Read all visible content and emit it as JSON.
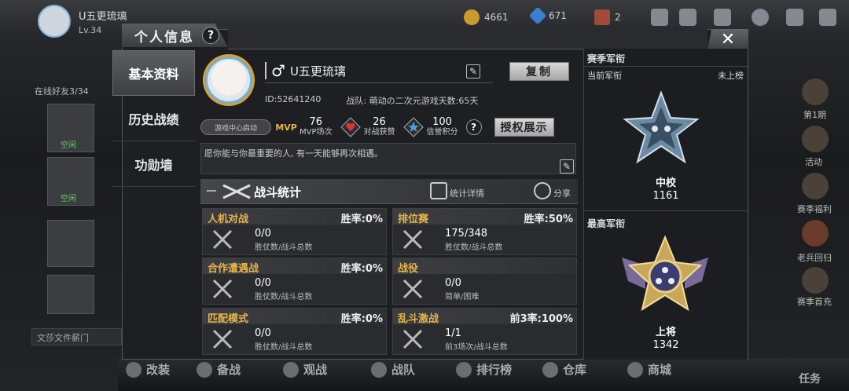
{
  "topbar": {
    "player_name": "U五更琉璃",
    "level": "Lv.34",
    "gold": "4661",
    "diamond": "671",
    "tickets": "2"
  },
  "bg": {
    "online_friends": "在线好友3/34",
    "friend1_status": "空闲",
    "friend2_status": "空闲",
    "chat_text": "文莎文件薪门",
    "right_items": [
      "第1期",
      "活动",
      "赛季福利",
      "老兵回归",
      "赛季首充"
    ],
    "bottom_items": [
      "改装",
      "备战",
      "观战",
      "战队",
      "排行榜",
      "仓库",
      "商城"
    ],
    "task": "任务"
  },
  "modal": {
    "title": "个人信息",
    "help": "?",
    "close": "✕"
  },
  "nav": {
    "items": [
      {
        "label": "基本资料"
      },
      {
        "label": "历史战绩"
      },
      {
        "label": "功勋墙"
      }
    ]
  },
  "profile": {
    "gender_symbol": "♂",
    "name": "U五更琉璃",
    "copy_label": "复制",
    "id_line": "ID:52641240",
    "team_line": "战队:  萌动の二次元游戏天数:65天",
    "game_center": "游戏中心启动",
    "mvp_value": "76",
    "mvp_label": "MVP场次",
    "likes_value": "26",
    "likes_label": "对战获赞",
    "credit_value": "100",
    "credit_label": "信誉积分",
    "help": "?",
    "auth_label": "授权展示",
    "motto": "愿你能与你最重要的人, 有一天能够再次相遇。"
  },
  "battle": {
    "title": "战斗统计",
    "details": "统计详情",
    "share": "分享",
    "cards": [
      {
        "name": "人机对战",
        "rate": "胜率:0%",
        "value": "0/0",
        "sub": "胜仗数/战斗总数"
      },
      {
        "name": "排位赛",
        "rate": "胜率:50%",
        "value": "175/348",
        "sub": "胜仗数/战斗总数"
      },
      {
        "name": "合作遭遇战",
        "rate": "胜率:0%",
        "value": "0/0",
        "sub": "胜仗数/战斗总数"
      },
      {
        "name": "战役",
        "rate": "",
        "value": "0/0",
        "sub": "简单/困难"
      },
      {
        "name": "匹配模式",
        "rate": "胜率:0%",
        "value": "0/0",
        "sub": "胜仗数/战斗总数"
      },
      {
        "name": "乱斗激战",
        "rate": "前3率:100%",
        "value": "1/1",
        "sub": "前3场次/战斗总数"
      }
    ]
  },
  "season": {
    "title": "赛季军衔",
    "current_label": "当前军衔",
    "current_status": "未上榜",
    "current_rank": "中校",
    "current_score": "1161",
    "best_title": "最高军衔",
    "best_rank": "上将",
    "best_score": "1342"
  }
}
